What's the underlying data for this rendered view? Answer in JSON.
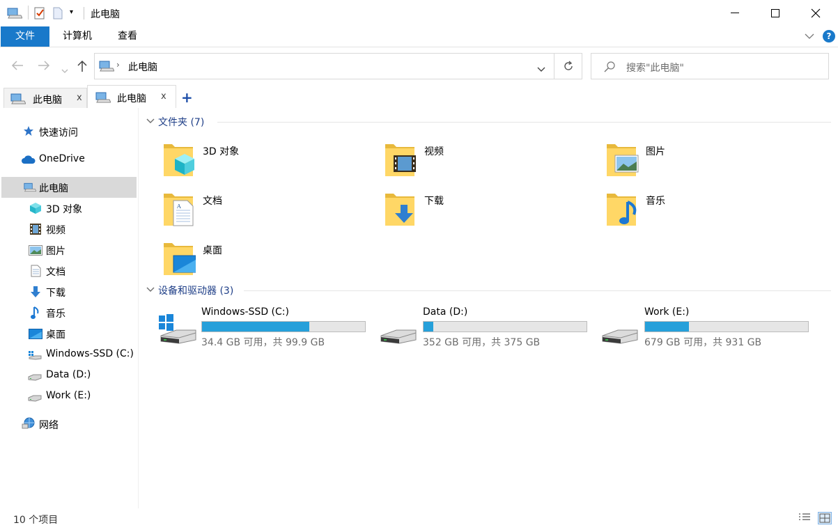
{
  "window": {
    "title": "此电脑",
    "minimize_glyph": "—",
    "maximize_glyph": "☐",
    "close_glyph": "✕"
  },
  "ribbon": {
    "tabs": [
      "文件",
      "计算机",
      "查看"
    ]
  },
  "nav": {
    "address": "此电脑",
    "search_placeholder": "搜索\"此电脑\""
  },
  "tabs": {
    "items": [
      {
        "label": "此电脑",
        "active": false
      },
      {
        "label": "此电脑",
        "active": true
      }
    ],
    "close_glyph": "x",
    "add_glyph": "+"
  },
  "sidebar": {
    "quick_access": "快速访问",
    "onedrive": "OneDrive",
    "this_pc": "此电脑",
    "children": [
      "3D 对象",
      "视频",
      "图片",
      "文档",
      "下载",
      "音乐",
      "桌面",
      "Windows-SSD (C:)",
      "Data (D:)",
      "Work (E:)"
    ],
    "network": "网络"
  },
  "main": {
    "folders_header": "文件夹 (7)",
    "folders": [
      {
        "name": "3D 对象",
        "icon": "3d-objects-folder-icon"
      },
      {
        "name": "视频",
        "icon": "videos-folder-icon"
      },
      {
        "name": "图片",
        "icon": "pictures-folder-icon"
      },
      {
        "name": "文档",
        "icon": "documents-folder-icon"
      },
      {
        "name": "下载",
        "icon": "downloads-folder-icon"
      },
      {
        "name": "音乐",
        "icon": "music-folder-icon"
      },
      {
        "name": "桌面",
        "icon": "desktop-folder-icon"
      }
    ],
    "drives_header": "设备和驱动器 (3)",
    "drives": [
      {
        "name": "Windows-SSD (C:)",
        "space": "34.4 GB 可用，共 99.9 GB",
        "used_fraction": 0.656
      },
      {
        "name": "Data (D:)",
        "space": "352 GB 可用，共 375 GB",
        "used_fraction": 0.061
      },
      {
        "name": "Work (E:)",
        "space": "679 GB 可用，共 931 GB",
        "used_fraction": 0.271
      }
    ]
  },
  "status": {
    "item_count": "10 个项目"
  },
  "colors": {
    "accent": "#1979ca",
    "drive_bar": "#26a0da",
    "group_header": "#1e3e87",
    "selected_bg": "#d9d9d9"
  }
}
